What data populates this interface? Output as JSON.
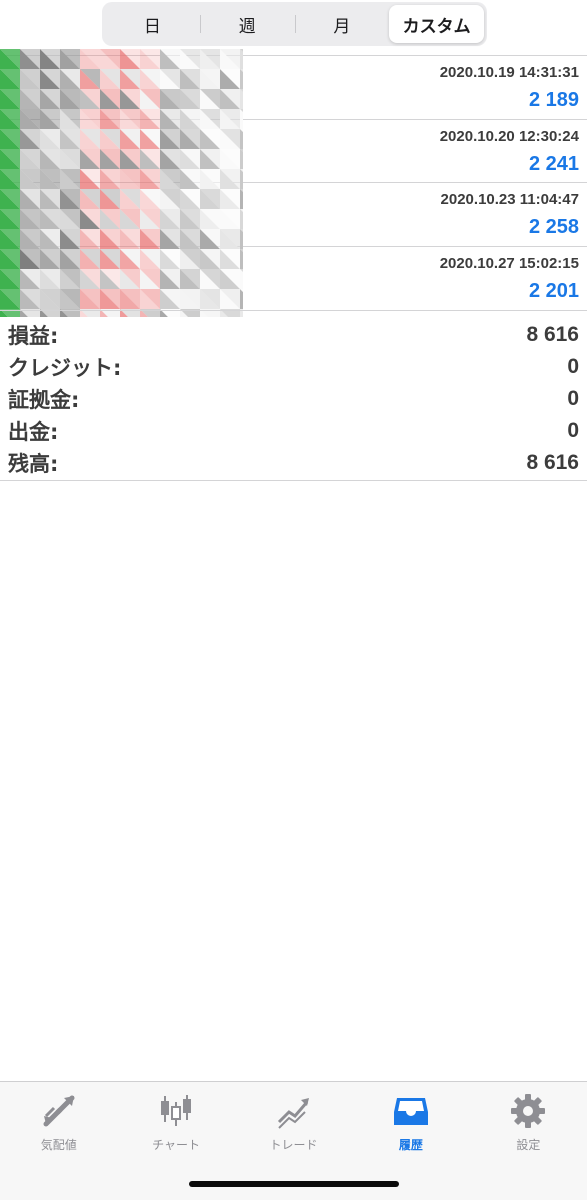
{
  "period_tabs": [
    {
      "label": "日",
      "active": false
    },
    {
      "label": "週",
      "active": false
    },
    {
      "label": "月",
      "active": false
    },
    {
      "label": "カスタム",
      "active": true
    }
  ],
  "history": [
    {
      "time": "2020.10.19 14:31:31",
      "amount": "2 189"
    },
    {
      "time": "2020.10.20 12:30:24",
      "amount": "2 241"
    },
    {
      "time": "2020.10.23 11:04:47",
      "amount": "2 258"
    },
    {
      "time": "2020.10.27 15:02:15",
      "amount": "2 201"
    }
  ],
  "summary": [
    {
      "label": "損益:",
      "value": "8 616"
    },
    {
      "label": "クレジット:",
      "value": "0"
    },
    {
      "label": "証拠金:",
      "value": "0"
    },
    {
      "label": "出金:",
      "value": "0"
    },
    {
      "label": "残高:",
      "value": "8 616"
    }
  ],
  "tabbar": [
    {
      "label": "気配値",
      "icon": "quotes-arrows-icon",
      "active": false
    },
    {
      "label": "チャート",
      "icon": "candlestick-chart-icon",
      "active": false
    },
    {
      "label": "トレード",
      "icon": "trade-trend-icon",
      "active": false
    },
    {
      "label": "履歴",
      "icon": "history-inbox-icon",
      "active": true
    },
    {
      "label": "設定",
      "icon": "settings-gear-icon",
      "active": false
    }
  ],
  "colors": {
    "accent": "#1a78e6",
    "text": "#3c3c3c",
    "inactive": "#8e8e93",
    "divider": "#d4d4d6"
  }
}
